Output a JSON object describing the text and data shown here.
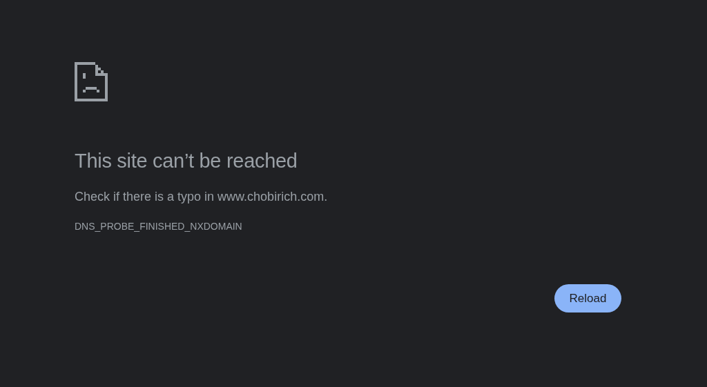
{
  "heading": "This site can’t be reached",
  "message": "Check if there is a typo in www.chobirich.com.",
  "error_code": "DNS_PROBE_FINISHED_NXDOMAIN",
  "buttons": [
    {
      "label": "Reload"
    }
  ]
}
